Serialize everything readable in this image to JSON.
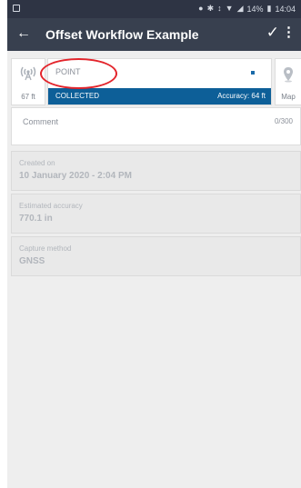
{
  "status_bar": {
    "battery": "14%",
    "time": "14:04",
    "icons": [
      "location-icon",
      "bluetooth-icon",
      "vibrate-icon",
      "wifi-icon",
      "signal-icon",
      "battery-icon"
    ]
  },
  "app_bar": {
    "title": "Offset Workflow Example",
    "back_icon": "←",
    "confirm_icon": "✓",
    "more_icon": "⋮"
  },
  "feature": {
    "distance": "67 ft",
    "type": "POINT",
    "status": "COLLECTED",
    "accuracy": "Accuracy: 64 ft",
    "map_label": "Map"
  },
  "comment": {
    "placeholder": "Comment",
    "counter": "0/300"
  },
  "fields": [
    {
      "label": "Created on",
      "value": "10 January 2020 - 2:04 PM"
    },
    {
      "label": "Estimated accuracy",
      "value": "770.1 in"
    },
    {
      "label": "Capture method",
      "value": "GNSS"
    }
  ],
  "colors": {
    "status_bar": "#2e3444",
    "app_bar": "#38404f",
    "collected_strip": "#0d5f98",
    "highlight_ellipse": "#e3242b"
  }
}
